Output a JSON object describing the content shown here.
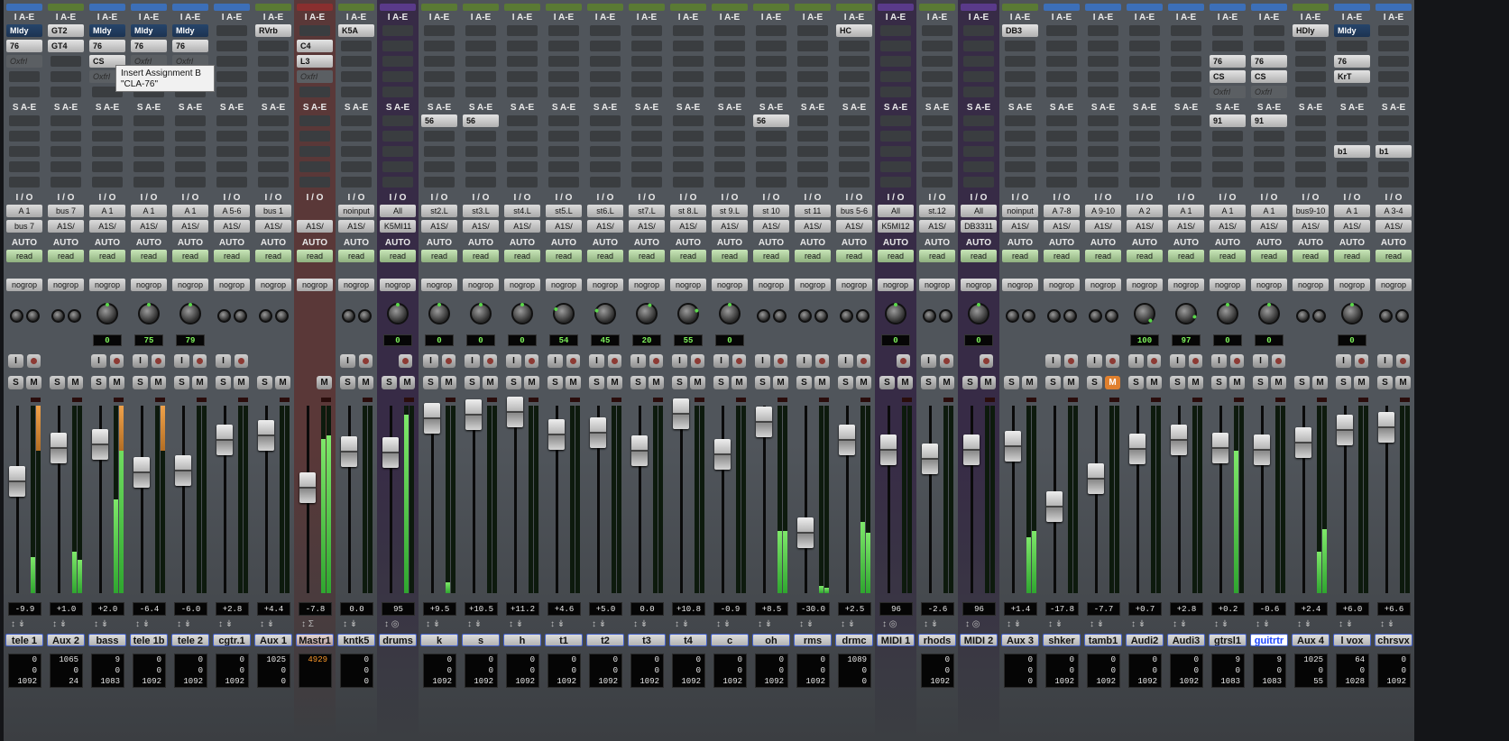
{
  "labels": {
    "inserts_ae": "I A-E",
    "sends_ae": "S A-E",
    "io": "I / O",
    "auto": "AUTO",
    "input_label": "I",
    "solo_label": "S",
    "mute_label": "M"
  },
  "tooltip": {
    "title": "Insert Assignment B",
    "value": "\"CLA-76\""
  },
  "colors": {
    "insert_active": "#26456b",
    "meter_green": "#5cd14a",
    "clip_orange": "#f0a24a",
    "selection_blue": "#1d46ff",
    "mute_active": "#e0802e"
  },
  "strips": [
    {
      "name": "tele 1",
      "color": "#3c6fb8",
      "inserts": [
        {
          "t": "Mldy",
          "s": "active"
        },
        {
          "t": "76",
          "s": "plug"
        },
        {
          "t": "Oxfrl",
          "s": "inactive"
        }
      ],
      "sends": [],
      "in": "A 1",
      "out": "bus 7",
      "auto": "read",
      "grp": "nogrop",
      "pan": "",
      "vol": "-9.9",
      "ctr": [
        "0",
        "0",
        "1092"
      ]
    },
    {
      "name": "Aux 2",
      "color": "#5a7a34",
      "inserts": [
        {
          "t": "GT2",
          "s": "plug"
        },
        {
          "t": "GT4",
          "s": "plug"
        }
      ],
      "sends": [],
      "in": "bus 7",
      "out": "A1S/",
      "auto": "read",
      "grp": "nogrop",
      "pan": "",
      "vol": "+1.0",
      "ctr": [
        "1065",
        "0",
        "24"
      ]
    },
    {
      "name": "bass",
      "color": "#3c6fb8",
      "inserts": [
        {
          "t": "Mldy",
          "s": "active"
        },
        {
          "t": "76",
          "s": "plug"
        },
        {
          "t": "CS",
          "s": "plug"
        },
        {
          "t": "Oxfrl",
          "s": "inactive"
        }
      ],
      "sends": [],
      "in": "A 1",
      "out": "A1S/",
      "auto": "read",
      "grp": "nogrop",
      "pan": "0",
      "vol": "+2.0",
      "ctr": [
        "9",
        "0",
        "1083"
      ]
    },
    {
      "name": "tele 1b",
      "color": "#3c6fb8",
      "inserts": [
        {
          "t": "Mldy",
          "s": "active"
        },
        {
          "t": "76",
          "s": "plug"
        },
        {
          "t": "Oxfrl",
          "s": "inactive"
        }
      ],
      "sends": [],
      "in": "A 1",
      "out": "A1S/",
      "auto": "read",
      "grp": "nogrop",
      "pan": "75",
      "vol": "-6.4",
      "ctr": [
        "0",
        "0",
        "1092"
      ]
    },
    {
      "name": "tele 2",
      "color": "#3c6fb8",
      "inserts": [
        {
          "t": "Mldy",
          "s": "active"
        },
        {
          "t": "76",
          "s": "plug"
        },
        {
          "t": "Oxfrl",
          "s": "inactive"
        }
      ],
      "sends": [],
      "in": "A 1",
      "out": "A1S/",
      "auto": "read",
      "grp": "nogrop",
      "pan": "79",
      "vol": "-6.0",
      "ctr": [
        "0",
        "0",
        "1092"
      ]
    },
    {
      "name": "cgtr.1",
      "color": "#3c6fb8",
      "inserts": [],
      "sends": [],
      "in": "A 5-6",
      "out": "A1S/",
      "auto": "read",
      "grp": "nogrop",
      "pan": "",
      "vol": "+2.8",
      "ctr": [
        "0",
        "0",
        "1092"
      ]
    },
    {
      "name": "Aux 1",
      "color": "#5a7a34",
      "inserts": [
        {
          "t": "RVrb",
          "s": "plug"
        }
      ],
      "sends": [],
      "in": "bus 1",
      "out": "A1S/",
      "auto": "read",
      "grp": "nogrop",
      "pan": "",
      "vol": "+4.4",
      "ctr": [
        "1025",
        "0",
        "0"
      ]
    },
    {
      "name": "Mastr1",
      "color": "#8a2f2f",
      "inserts": [
        {
          "t": "",
          "s": "empty"
        },
        {
          "t": "C4",
          "s": "plug"
        },
        {
          "t": "L3",
          "s": "plug"
        },
        {
          "t": "Oxfrl",
          "s": "inactive"
        }
      ],
      "sends": [],
      "in": "",
      "out": "A1S/",
      "auto": "read",
      "grp": "nogrop",
      "pan": "",
      "vol": "-7.8",
      "ctr": [
        "4929",
        "",
        ""
      ]
    },
    {
      "name": "kntk5",
      "color": "#5a7a34",
      "inserts": [
        {
          "t": "K5A",
          "s": "plug"
        }
      ],
      "sends": [],
      "in": "noinput",
      "out": "A1S/",
      "auto": "read",
      "grp": "nogrop",
      "pan": "",
      "vol": "0.0",
      "ctr": [
        "0",
        "0",
        "0"
      ]
    },
    {
      "name": "drums",
      "color": "#5a3a8a",
      "inserts": [],
      "sends": [],
      "in": "All",
      "out": "K5MI11",
      "auto": "read",
      "grp": "nogrop",
      "pan": "0",
      "vol": "95",
      "ctr": []
    },
    {
      "name": "k",
      "color": "#5a7a34",
      "inserts": [],
      "sends": [
        {
          "t": "56"
        }
      ],
      "in": "st2.L",
      "out": "A1S/",
      "auto": "read",
      "grp": "nogrop",
      "pan": "0",
      "vol": "+9.5",
      "ctr": [
        "0",
        "0",
        "1092"
      ]
    },
    {
      "name": "s",
      "color": "#5a7a34",
      "inserts": [],
      "sends": [
        {
          "t": "56"
        }
      ],
      "in": "st3.L",
      "out": "A1S/",
      "auto": "read",
      "grp": "nogrop",
      "pan": "0",
      "vol": "+10.5",
      "ctr": [
        "0",
        "0",
        "1092"
      ]
    },
    {
      "name": "h",
      "color": "#5a7a34",
      "inserts": [],
      "sends": [],
      "in": "st4.L",
      "out": "A1S/",
      "auto": "read",
      "grp": "nogrop",
      "pan": "0",
      "vol": "+11.2",
      "ctr": [
        "0",
        "0",
        "1092"
      ]
    },
    {
      "name": "t1",
      "color": "#5a7a34",
      "inserts": [],
      "sends": [],
      "in": "st5.L",
      "out": "A1S/",
      "auto": "read",
      "grp": "nogrop",
      "pan": "54",
      "vol": "+4.6",
      "ctr": [
        "0",
        "0",
        "1092"
      ]
    },
    {
      "name": "t2",
      "color": "#5a7a34",
      "inserts": [],
      "sends": [],
      "in": "st6.L",
      "out": "A1S/",
      "auto": "read",
      "grp": "nogrop",
      "pan": "45",
      "vol": "+5.0",
      "ctr": [
        "0",
        "0",
        "1092"
      ]
    },
    {
      "name": "t3",
      "color": "#5a7a34",
      "inserts": [],
      "sends": [],
      "in": "st7.L",
      "out": "A1S/",
      "auto": "read",
      "grp": "nogrop",
      "pan": "20",
      "vol": "0.0",
      "ctr": [
        "0",
        "0",
        "1092"
      ]
    },
    {
      "name": "t4",
      "color": "#5a7a34",
      "inserts": [],
      "sends": [],
      "in": "st 8.L",
      "out": "A1S/",
      "auto": "read",
      "grp": "nogrop",
      "pan": "55",
      "vol": "+10.8",
      "ctr": [
        "0",
        "0",
        "1092"
      ]
    },
    {
      "name": "c",
      "color": "#5a7a34",
      "inserts": [],
      "sends": [],
      "in": "st 9.L",
      "out": "A1S/",
      "auto": "read",
      "grp": "nogrop",
      "pan": "0",
      "vol": "-0.9",
      "ctr": [
        "0",
        "0",
        "1092"
      ]
    },
    {
      "name": "oh",
      "color": "#5a7a34",
      "inserts": [],
      "sends": [
        {
          "t": "56"
        }
      ],
      "in": "st 10",
      "out": "A1S/",
      "auto": "read",
      "grp": "nogrop",
      "pan": "",
      "vol": "+8.5",
      "ctr": [
        "0",
        "0",
        "1092"
      ]
    },
    {
      "name": "rms",
      "color": "#5a7a34",
      "inserts": [],
      "sends": [],
      "in": "st 11",
      "out": "A1S/",
      "auto": "read",
      "grp": "nogrop",
      "pan": "",
      "vol": "-30.0",
      "ctr": [
        "0",
        "0",
        "1092"
      ]
    },
    {
      "name": "drmc",
      "color": "#5a7a34",
      "inserts": [
        {
          "t": "HC",
          "s": "plug"
        }
      ],
      "sends": [],
      "in": "bus 5-6",
      "out": "A1S/",
      "auto": "read",
      "grp": "nogrop",
      "pan": "",
      "vol": "+2.5",
      "ctr": [
        "1089",
        "0",
        "0"
      ]
    },
    {
      "name": "MIDI 1",
      "color": "#5a3a8a",
      "inserts": [],
      "sends": [],
      "in": "All",
      "out": "K5MI12",
      "auto": "read",
      "grp": "nogrop",
      "pan": "0",
      "vol": "96",
      "ctr": []
    },
    {
      "name": "rhods",
      "color": "#5a7a34",
      "inserts": [],
      "sends": [],
      "in": "st.12",
      "out": "A1S/",
      "auto": "read",
      "grp": "nogrop",
      "pan": "",
      "vol": "-2.6",
      "ctr": [
        "0",
        "0",
        "1092"
      ]
    },
    {
      "name": "MIDI 2",
      "color": "#5a3a8a",
      "inserts": [],
      "sends": [],
      "in": "All",
      "out": "DB3311",
      "auto": "read",
      "grp": "nogrop",
      "pan": "0",
      "vol": "96",
      "ctr": []
    },
    {
      "name": "Aux 3",
      "color": "#5a7a34",
      "inserts": [
        {
          "t": "DB3",
          "s": "plug"
        }
      ],
      "sends": [],
      "in": "noinput",
      "out": "A1S/",
      "auto": "read",
      "grp": "nogrop",
      "pan": "",
      "vol": "+1.4",
      "ctr": [
        "0",
        "0",
        "0"
      ]
    },
    {
      "name": "shker",
      "color": "#3c6fb8",
      "inserts": [],
      "sends": [],
      "in": "A 7-8",
      "out": "A1S/",
      "auto": "read",
      "grp": "nogrop",
      "pan": "",
      "vol": "-17.8",
      "ctr": [
        "0",
        "0",
        "1092"
      ]
    },
    {
      "name": "tamb1",
      "color": "#3c6fb8",
      "inserts": [],
      "sends": [],
      "in": "A 9-10",
      "out": "A1S/",
      "auto": "read",
      "grp": "nogrop",
      "pan": "",
      "vol": "-7.7",
      "ctr": [
        "0",
        "0",
        "1092"
      ],
      "mute": true
    },
    {
      "name": "Audi2",
      "color": "#3c6fb8",
      "inserts": [],
      "sends": [],
      "in": "A 2",
      "out": "A1S/",
      "auto": "read",
      "grp": "nogrop",
      "pan": "100",
      "vol": "+0.7",
      "ctr": [
        "0",
        "0",
        "1092"
      ]
    },
    {
      "name": "Audi3",
      "color": "#3c6fb8",
      "inserts": [],
      "sends": [],
      "in": "A 1",
      "out": "A1S/",
      "auto": "read",
      "grp": "nogrop",
      "pan": "97",
      "vol": "+2.8",
      "ctr": [
        "0",
        "0",
        "1092"
      ]
    },
    {
      "name": "gtrsl1",
      "color": "#3c6fb8",
      "inserts": [
        {
          "t": "",
          "s": "empty"
        },
        {
          "t": "",
          "s": "empty"
        },
        {
          "t": "76",
          "s": "plug"
        },
        {
          "t": "CS",
          "s": "plug"
        },
        {
          "t": "Oxfrl",
          "s": "inactive"
        }
      ],
      "sends": [
        {
          "t": "91"
        }
      ],
      "in": "A 1",
      "out": "A1S/",
      "auto": "read",
      "grp": "nogrop",
      "pan": "0",
      "vol": "+0.2",
      "ctr": [
        "9",
        "0",
        "1083"
      ]
    },
    {
      "name": "guitrtr",
      "color": "#3c6fb8",
      "inserts": [
        {
          "t": "",
          "s": "empty"
        },
        {
          "t": "",
          "s": "empty"
        },
        {
          "t": "76",
          "s": "plug"
        },
        {
          "t": "CS",
          "s": "plug"
        },
        {
          "t": "Oxfrl",
          "s": "inactive"
        }
      ],
      "sends": [
        {
          "t": "91"
        }
      ],
      "in": "A 1",
      "out": "A1S/",
      "auto": "read",
      "grp": "nogrop",
      "pan": "0",
      "vol": "-0.6",
      "ctr": [
        "9",
        "0",
        "1083"
      ],
      "selected": true
    },
    {
      "name": "Aux 4",
      "color": "#5a7a34",
      "inserts": [
        {
          "t": "HDly",
          "s": "plug"
        }
      ],
      "sends": [],
      "in": "bus9-10",
      "out": "A1S/",
      "auto": "read",
      "grp": "nogrop",
      "pan": "",
      "vol": "+2.4",
      "ctr": [
        "1025",
        "0",
        "55"
      ]
    },
    {
      "name": "l vox",
      "color": "#3c6fb8",
      "inserts": [
        {
          "t": "Mldy",
          "s": "active"
        },
        {
          "t": "",
          "s": "empty"
        },
        {
          "t": "76",
          "s": "plug"
        },
        {
          "t": "KrT",
          "s": "plug"
        }
      ],
      "sends": [
        {
          "t": "",
          "s": "empty"
        },
        {
          "t": "",
          "s": "empty"
        },
        {
          "t": "b1"
        }
      ],
      "in": "A 1",
      "out": "A1S/",
      "auto": "read",
      "grp": "nogrop",
      "pan": "0",
      "vol": "+6.0",
      "ctr": [
        "64",
        "0",
        "1028"
      ]
    },
    {
      "name": "chrsvx",
      "color": "#3c6fb8",
      "inserts": [],
      "sends": [
        {
          "t": "",
          "s": "empty"
        },
        {
          "t": "",
          "s": "empty"
        },
        {
          "t": "b1"
        }
      ],
      "in": "A 3-4",
      "out": "A1S/",
      "auto": "read",
      "grp": "nogrop",
      "pan": "",
      "vol": "+6.6",
      "ctr": [
        "0",
        "0",
        "1092"
      ]
    }
  ]
}
